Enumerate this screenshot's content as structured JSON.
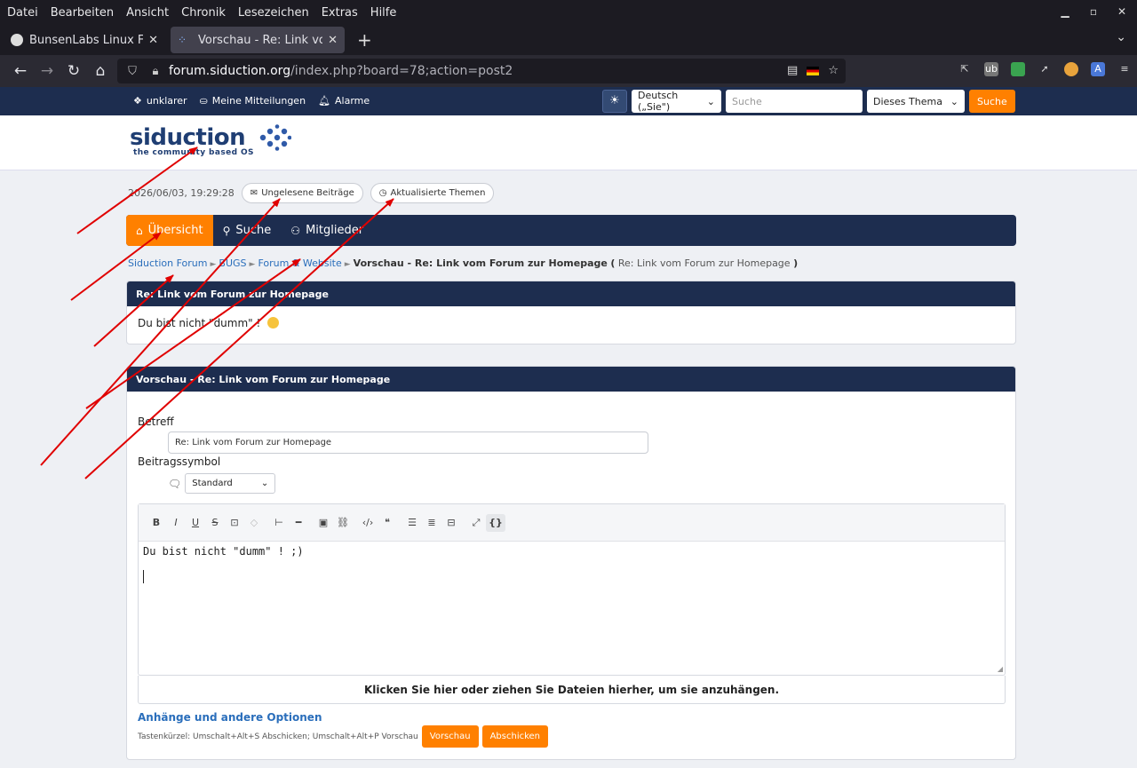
{
  "browser": {
    "menu": [
      "Datei",
      "Bearbeiten",
      "Ansicht",
      "Chronik",
      "Lesezeichen",
      "Extras",
      "Hilfe"
    ],
    "tabs": [
      {
        "title": "BunsenLabs Linux Forums"
      },
      {
        "title": "Vorschau - Re: Link vom F"
      }
    ],
    "url_host": "forum.siduction.org",
    "url_path": "/index.php?board=78;action=post2"
  },
  "userbar": {
    "user": "unklarer",
    "posts": "Meine Mitteilungen",
    "alerts": "Alarme",
    "language": "Deutsch („Sie\")",
    "search_placeholder": "Suche",
    "scope": "Dieses Thema",
    "search_button": "Suche"
  },
  "logo": {
    "name": "siduction",
    "tagline": "the community based OS"
  },
  "info": {
    "datetime": "2026/06/03, 19:29:28",
    "unread": "Ungelesene Beiträge",
    "updated": "Aktualisierte Themen"
  },
  "mainnav": {
    "home": "Übersicht",
    "search": "Suche",
    "members": "Mitglieder"
  },
  "breadcrumb": {
    "forum": "Siduction Forum",
    "bugs": "BUGS",
    "board": "Forum & Website",
    "current": "Vorschau - Re: Link vom Forum zur Homepage",
    "paren": "Re: Link vom Forum zur Homepage"
  },
  "preview": {
    "title": "Re: Link vom Forum zur Homepage",
    "body": "Du bist nicht \"dumm\" ! "
  },
  "form": {
    "title": "Vorschau - Re: Link vom Forum zur Homepage",
    "subject_label": "Betreff",
    "subject_value": "Re: Link vom Forum zur Homepage",
    "icon_label": "Beitragssymbol",
    "icon_value": "Standard",
    "message": "Du bist nicht \"dumm\" !  ;)",
    "dropzone": "Klicken Sie hier oder ziehen Sie Dateien hierher, um sie anzuhängen.",
    "more_options": "Anhänge und andere Optionen",
    "shortcuts": "Tastenkürzel: Umschalt+Alt+S Abschicken; Umschalt+Alt+P Vorschau",
    "preview_button": "Vorschau",
    "submit_button": "Abschicken"
  },
  "colors": {
    "accent": "#ff8000",
    "navy": "#1d2d4f",
    "link": "#2a6ebb",
    "arrow": "#e00000"
  }
}
